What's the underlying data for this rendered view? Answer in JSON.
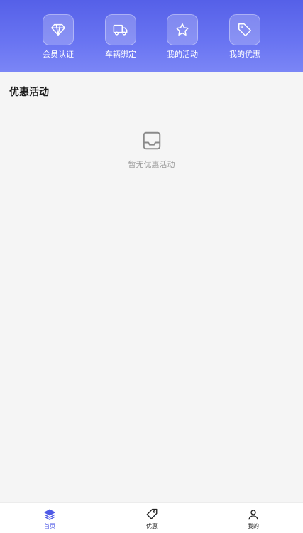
{
  "header": {
    "shortcuts": [
      {
        "label": "会员认证",
        "icon": "diamond-icon"
      },
      {
        "label": "车辆绑定",
        "icon": "truck-icon"
      },
      {
        "label": "我的活动",
        "icon": "star-icon"
      },
      {
        "label": "我的优惠",
        "icon": "tag-icon"
      }
    ]
  },
  "main": {
    "section_title": "优惠活动",
    "empty_text": "暂无优惠活动",
    "empty_icon": "inbox-icon"
  },
  "tabbar": {
    "tabs": [
      {
        "label": "首页",
        "icon": "layers-icon",
        "active": true
      },
      {
        "label": "优惠",
        "icon": "tag-icon",
        "active": false
      },
      {
        "label": "我的",
        "icon": "user-icon",
        "active": false
      }
    ]
  },
  "colors": {
    "header_gradient_start": "#5560e8",
    "header_gradient_end": "#7b86f6",
    "accent": "#4f5ae6",
    "background": "#f5f5f5"
  }
}
